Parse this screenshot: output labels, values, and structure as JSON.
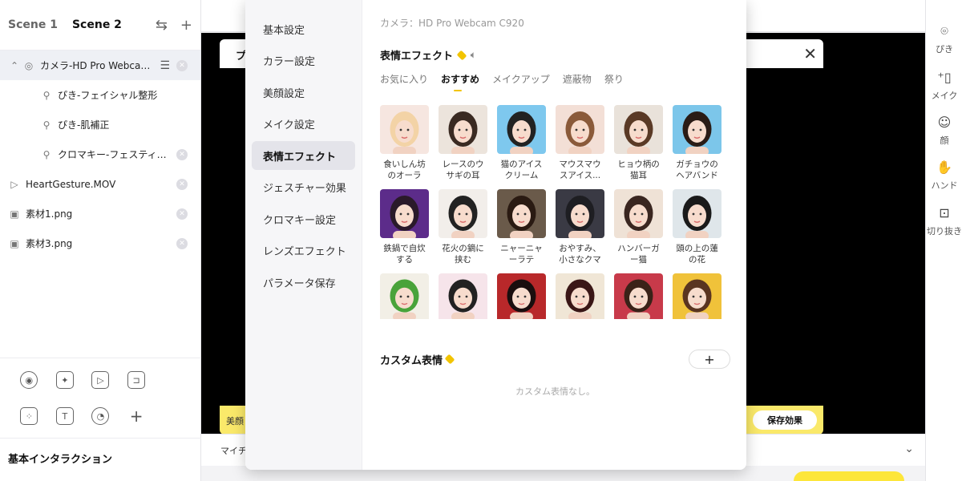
{
  "scenes": {
    "tabs": [
      "Scene 1",
      "Scene 2"
    ],
    "active": 1
  },
  "sources": [
    {
      "label": "カメラ-HD Pro Webcam ...",
      "icon": "camera-icon",
      "selected": true
    },
    {
      "label": "ぴき-フェイシャル整形",
      "icon": "filter-icon",
      "child": true
    },
    {
      "label": "ぴき-肌補正",
      "icon": "filter-icon",
      "child": true
    },
    {
      "label": "クロマキー-フェスティバ...",
      "icon": "filter-icon",
      "child": true
    },
    {
      "label": "HeartGesture.MOV",
      "icon": "video-icon"
    },
    {
      "label": "素材1.png",
      "icon": "image-icon"
    },
    {
      "label": "素材3.png",
      "icon": "image-icon"
    }
  ],
  "left_footer": {
    "title": "基本インタラクション"
  },
  "preview": {
    "save_effect": "保存効果",
    "left_partial": "美顔",
    "title_partial": "プ",
    "bottom_partial": "マイチ"
  },
  "right_strip": [
    {
      "label": "ぴき",
      "icon": "beauty-icon"
    },
    {
      "label": "メイク",
      "icon": "makeup-icon"
    },
    {
      "label": "顔",
      "icon": "face-icon"
    },
    {
      "label": "ハンド",
      "icon": "hand-icon"
    },
    {
      "label": "切り抜き",
      "icon": "cutout-icon"
    }
  ],
  "settings": {
    "menu": [
      "基本設定",
      "カラー設定",
      "美顔設定",
      "メイク設定",
      "表情エフェクト",
      "ジェスチャー効果",
      "クロマキー設定",
      "レンズエフェクト",
      "パラメータ保存"
    ],
    "active_menu": 4,
    "camera_label": "カメラ：HD Pro Webcam C920",
    "section_title": "表情エフェクト",
    "sub_tabs": [
      "お気に入り",
      "おすすめ",
      "メイクアップ",
      "遮蔽物",
      "祭り"
    ],
    "active_sub_tab": 1,
    "effects": [
      {
        "label": "食いしん坊のオーラ",
        "bg": "#f6e6e0",
        "hair": "#f3d3a6"
      },
      {
        "label": "レースのウサギの耳",
        "bg": "#ece4dc",
        "hair": "#3a2a22"
      },
      {
        "label": "猫のアイスクリーム",
        "bg": "#7ec8ee",
        "hair": "#222"
      },
      {
        "label": "マウスマウスアイス...",
        "bg": "#f3dfd6",
        "hair": "#8a5a3a"
      },
      {
        "label": "ヒョウ柄の猫耳",
        "bg": "#e9e2da",
        "hair": "#5a3a26"
      },
      {
        "label": "ガチョウのヘアバンド",
        "bg": "#7cc6ea",
        "hair": "#2a1c16"
      },
      {
        "label": "鉄鍋で自炊する",
        "bg": "#5c2c8a",
        "hair": "#2a1a2a"
      },
      {
        "label": "花火の鏑に挟む",
        "bg": "#f2eeea",
        "hair": "#222"
      },
      {
        "label": "ニャーニャーラテ",
        "bg": "#6a5a4a",
        "hair": "#2a1a12"
      },
      {
        "label": "おやすみ、小さなクマ",
        "bg": "#3a3a44",
        "hair": "#1e1e22"
      },
      {
        "label": "ハンバーガー猫",
        "bg": "#efe2d6",
        "hair": "#3a2620"
      },
      {
        "label": "頭の上の蓮の花",
        "bg": "#dfe6ea",
        "hair": "#1a1a1a"
      },
      {
        "label": "",
        "bg": "#f2efe6",
        "hair": "#49a33a"
      },
      {
        "label": "",
        "bg": "#f6e4ea",
        "hair": "#222"
      },
      {
        "label": "",
        "bg": "#b8282a",
        "hair": "#1a0e0e"
      },
      {
        "label": "",
        "bg": "#f0e6d6",
        "hair": "#3a1616"
      },
      {
        "label": "",
        "bg": "#c83a4a",
        "hair": "#3a2218"
      },
      {
        "label": "",
        "bg": "#f0c23a",
        "hair": "#5a3420"
      }
    ],
    "custom_title": "カスタム表情",
    "custom_add": "+",
    "custom_empty": "カスタム表情なし。"
  },
  "colors": {
    "accent": "#f2c400",
    "yellow": "#fae96a"
  }
}
